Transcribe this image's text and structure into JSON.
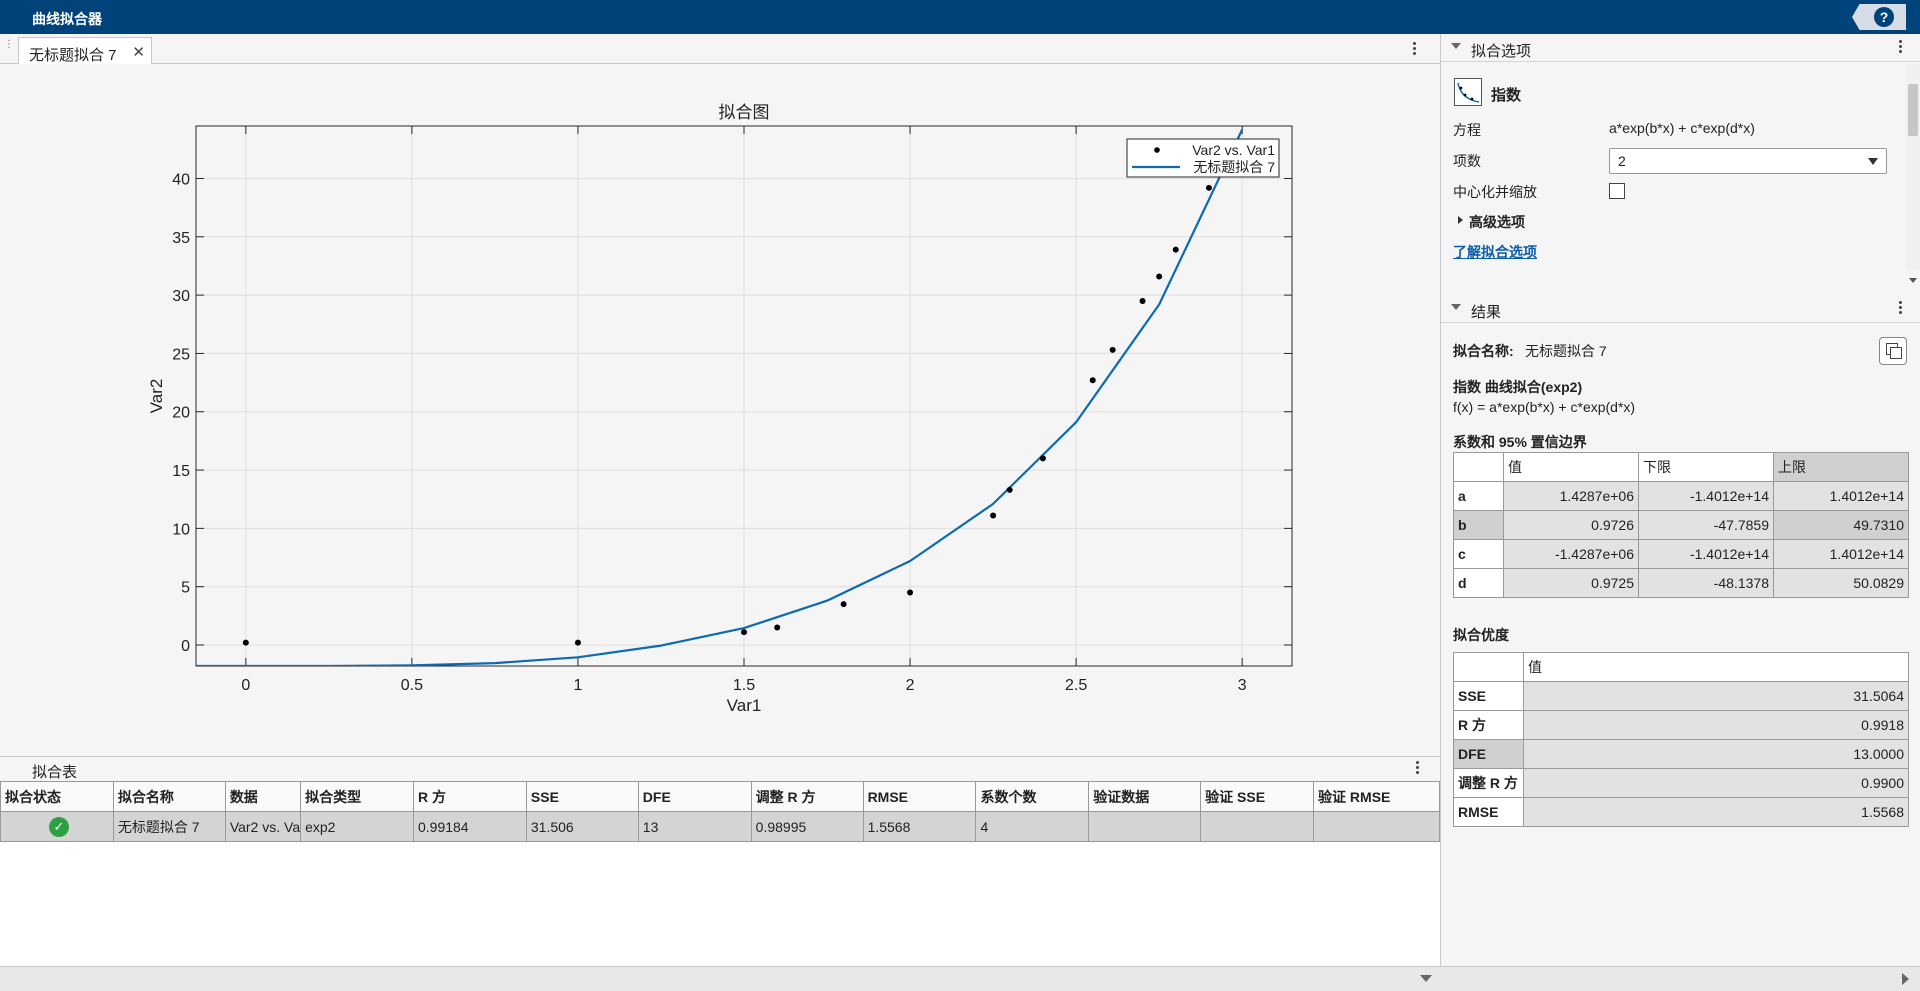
{
  "app_title": "曲线拟合器",
  "help_label": "?",
  "doc_tab": {
    "label": "无标题拟合 7",
    "close": "✕"
  },
  "plot": {
    "title": "拟合图",
    "xlabel": "Var1",
    "ylabel": "Var2",
    "legend": [
      "Var2 vs. Var1",
      "无标题拟合 7"
    ]
  },
  "chart_data": {
    "type": "scatter",
    "title": "拟合图",
    "xlabel": "Var1",
    "ylabel": "Var2",
    "xlim": [
      -0.15,
      3.15
    ],
    "ylim": [
      -1.8,
      44.5
    ],
    "xticks": [
      0,
      0.5,
      1,
      1.5,
      2,
      2.5,
      3
    ],
    "xtick_labels": [
      "0",
      "0.5",
      "1",
      "1.5",
      "2",
      "2.5",
      "3"
    ],
    "yticks": [
      0,
      5,
      10,
      15,
      20,
      25,
      30,
      35,
      40
    ],
    "ytick_labels": [
      "0",
      "5",
      "10",
      "15",
      "20",
      "25",
      "30",
      "35",
      "40"
    ],
    "grid": true,
    "legend_position": "top-right",
    "series": [
      {
        "name": "Var2 vs. Var1",
        "kind": "points",
        "x": [
          0,
          1,
          1.5,
          1.6,
          1.8,
          2.0,
          2.25,
          2.3,
          2.4,
          2.55,
          2.61,
          2.7,
          2.75,
          2.8,
          2.9
        ],
        "y": [
          0.2,
          0.2,
          1.1,
          1.5,
          3.5,
          4.5,
          11.1,
          13.3,
          16.0,
          22.7,
          25.3,
          29.5,
          31.6,
          33.9,
          39.2
        ]
      },
      {
        "name": "无标题拟合 7",
        "kind": "fit",
        "x": [
          -0.15,
          0,
          0.25,
          0.5,
          0.75,
          1.0,
          1.25,
          1.5,
          1.75,
          2.0,
          2.25,
          2.5,
          2.75,
          3.0
        ],
        "y": [
          -1.8,
          -1.8,
          -1.8,
          -1.75,
          -1.55,
          -1.05,
          -0.05,
          1.45,
          3.8,
          7.2,
          12.1,
          19.1,
          29.2,
          44.2
        ]
      }
    ],
    "colors": {
      "points": "#000000",
      "fit": "#0b6ab3"
    }
  },
  "fit_table": {
    "title": "拟合表",
    "columns": [
      "拟合状态",
      "拟合名称",
      "数据",
      "拟合类型",
      "R 方",
      "SSE",
      "DFE",
      "调整 R 方",
      "RMSE",
      "系数个数",
      "验证数据",
      "验证 SSE",
      "验证 RMSE"
    ],
    "rows": [
      {
        "status_icon": "check-circle-icon",
        "name": "无标题拟合 7",
        "data": "Var2 vs. Va",
        "type": "exp2",
        "r2": "0.99184",
        "sse": "31.506",
        "dfe": "13",
        "adj_r2": "0.98995",
        "rmse": "1.5568",
        "ncoef": "4",
        "val_data": "",
        "val_sse": "",
        "val_rmse": ""
      }
    ]
  },
  "fit_options": {
    "title": "拟合选项",
    "fit_type": "指数",
    "equation_label": "方程",
    "equation_value": "a*exp(b*x) + c*exp(d*x)",
    "terms_label": "项数",
    "terms_value": "2",
    "center_label": "中心化并缩放",
    "advanced_label": "高级选项",
    "learn_link": "了解拟合选项"
  },
  "results": {
    "title": "结果",
    "fit_name_label": "拟合名称:",
    "fit_name_value": "无标题拟合 7",
    "model_title": "指数 曲线拟合(exp2)",
    "model_formula": "f(x) = a*exp(b*x) + c*exp(d*x)",
    "coef_title": "系数和 95% 置信边界",
    "coef_headers": [
      "值",
      "下限",
      "上限"
    ],
    "coefs": [
      {
        "name": "a",
        "value": "1.4287e+06",
        "lower": "-1.4012e+14",
        "upper": "1.4012e+14"
      },
      {
        "name": "b",
        "value": "0.9726",
        "lower": "-47.7859",
        "upper": "49.7310"
      },
      {
        "name": "c",
        "value": "-1.4287e+06",
        "lower": "-1.4012e+14",
        "upper": "1.4012e+14"
      },
      {
        "name": "d",
        "value": "0.9725",
        "lower": "-48.1378",
        "upper": "50.0829"
      }
    ],
    "gof_title": "拟合优度",
    "gof_header": "值",
    "gof": [
      {
        "name": "SSE",
        "value": "31.5064"
      },
      {
        "name": "R 方",
        "value": "0.9918"
      },
      {
        "name": "DFE",
        "value": "13.0000"
      },
      {
        "name": "调整 R 方",
        "value": "0.9900"
      },
      {
        "name": "RMSE",
        "value": "1.5568"
      }
    ]
  }
}
